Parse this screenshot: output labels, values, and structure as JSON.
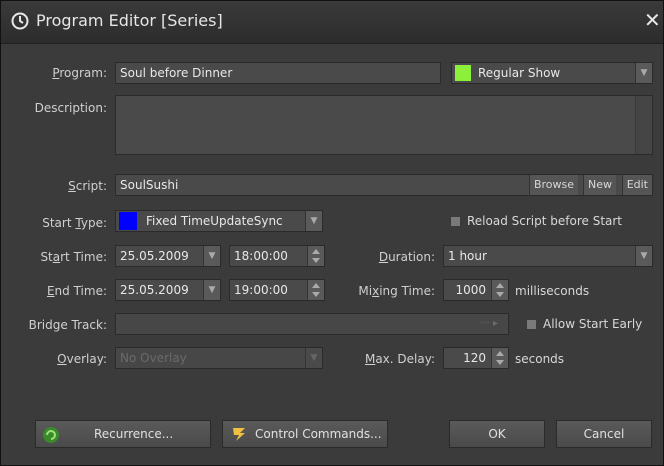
{
  "window": {
    "title": "Program Editor [Series]",
    "close": "✕"
  },
  "program": {
    "label": "Program:",
    "value": "Soul before Dinner",
    "type_value": "Regular Show",
    "type_color": "#8cf03a"
  },
  "description": {
    "label": "Description:",
    "value": ""
  },
  "script": {
    "label": "Script:",
    "value": "SoulSushi",
    "browse": "Browse",
    "new": "New",
    "edit": "Edit"
  },
  "start_type": {
    "label": "Start Type:",
    "value": "Fixed TimeUpdateSync",
    "color": "#0000ff"
  },
  "reload": {
    "label": "Reload Script before Start"
  },
  "start_time": {
    "label": "Start Time:",
    "date": "25.05.2009",
    "time": "18:00:00"
  },
  "end_time": {
    "label": "End Time:",
    "date": "25.05.2009",
    "time": "19:00:00"
  },
  "duration": {
    "label": "Duration:",
    "value": "1 hour"
  },
  "mixing": {
    "label": "Mixing Time:",
    "value": "1000",
    "unit": "milliseconds"
  },
  "bridge": {
    "label": "Bridge Track:",
    "value": "",
    "allow_label": "Allow Start Early"
  },
  "overlay": {
    "label": "Overlay:",
    "value": "No Overlay"
  },
  "delay": {
    "label": "Max. Delay:",
    "value": "120",
    "unit": "seconds"
  },
  "buttons": {
    "recurrence": "Recurrence...",
    "control": "Control Commands...",
    "ok": "OK",
    "cancel": "Cancel"
  }
}
